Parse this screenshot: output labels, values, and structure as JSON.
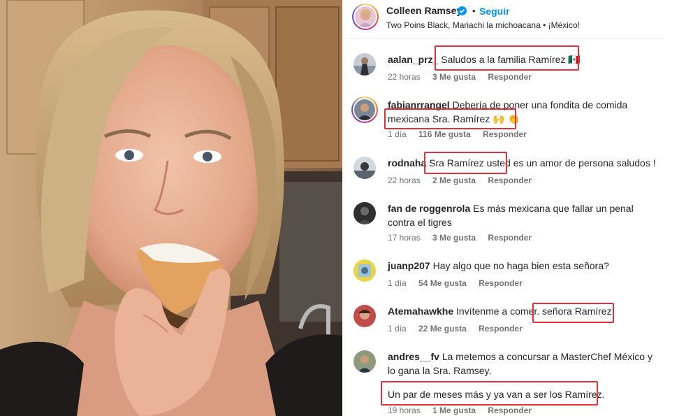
{
  "post": {
    "owner": "Colleen Ramsey",
    "follow_label": "Seguir",
    "separator": "•",
    "subtitle": "Two Poins Black, Mariachi la michoacana • ¡México!"
  },
  "comments": [
    {
      "user": "aalan_prz_",
      "text": "Saludos a la familia Ramírez 🇲🇽",
      "time": "22 horas",
      "likes": "3 Me gusta",
      "reply": "Responder"
    },
    {
      "user": "fabianrrangel",
      "text": "Debería de poner una fondita de comida mexicana Sra. Ramírez 🙌 👏",
      "time": "1 día",
      "likes": "116 Me gusta",
      "reply": "Responder"
    },
    {
      "user": "rodnaha",
      "text": "Sra Ramírez usted es un amor de persona saludos !",
      "time": "22 horas",
      "likes": "2 Me gusta",
      "reply": "Responder"
    },
    {
      "user": "fan de roggenrola",
      "text": "Es más mexicana que fallar un penal contra el tigres",
      "time": "17 horas",
      "likes": "3 Me gusta",
      "reply": "Responder"
    },
    {
      "user": "juanp207",
      "text": "Hay algo que no haga bien esta señora?",
      "time": "1 día",
      "likes": "54 Me gusta",
      "reply": "Responder"
    },
    {
      "user": "Atemahawkhe",
      "text": "Invítenme a comer. señora Ramírez",
      "time": "1 día",
      "likes": "22 Me gusta",
      "reply": "Responder"
    },
    {
      "user": "andres__fv",
      "text": "La metemos a concursar a MasterChef México y lo gana la Sra. Ramsey.",
      "text2": "Un par de meses más y ya van a ser los Ramírez.",
      "time": "19 horas",
      "likes": "1 Me gusta",
      "reply": "Responder"
    }
  ],
  "colors": {
    "highlight": "#e5303c",
    "link": "#0095f6",
    "muted": "#737373",
    "verified": "#0095f6"
  }
}
